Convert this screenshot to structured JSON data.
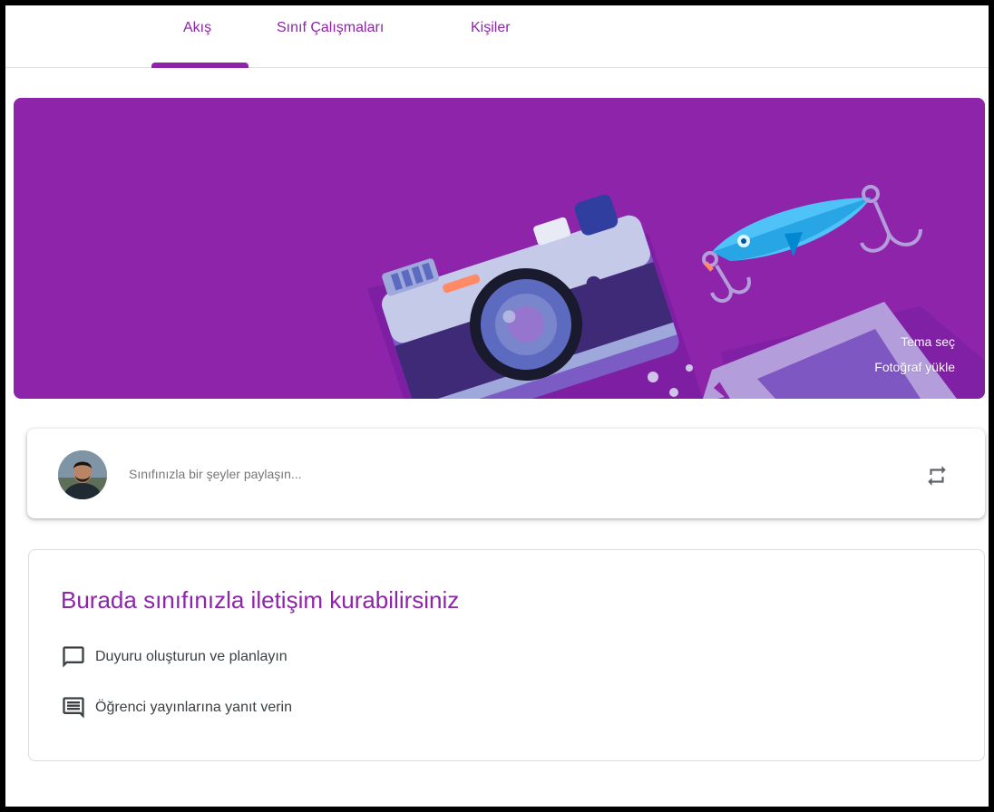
{
  "tabs": [
    {
      "label": "Akış",
      "active": true
    },
    {
      "label": "Sınıf Çalışmaları",
      "active": false
    },
    {
      "label": "Kişiler",
      "active": false
    }
  ],
  "banner": {
    "color": "#8e24aa",
    "select_theme": "Tema seç",
    "upload_photo": "Fotoğraf yükle"
  },
  "share": {
    "placeholder": "Sınıfınızla bir şeyler paylaşın...",
    "repost_icon": "repost-icon"
  },
  "info": {
    "title": "Burada sınıfınızla iletişim kurabilirsiniz",
    "items": [
      {
        "icon": "announcement-icon",
        "label": "Duyuru oluşturun ve planlayın"
      },
      {
        "icon": "comment-list-icon",
        "label": "Öğrenci yayınlarına yanıt verin"
      }
    ]
  },
  "accent_color": "#8e24aa"
}
